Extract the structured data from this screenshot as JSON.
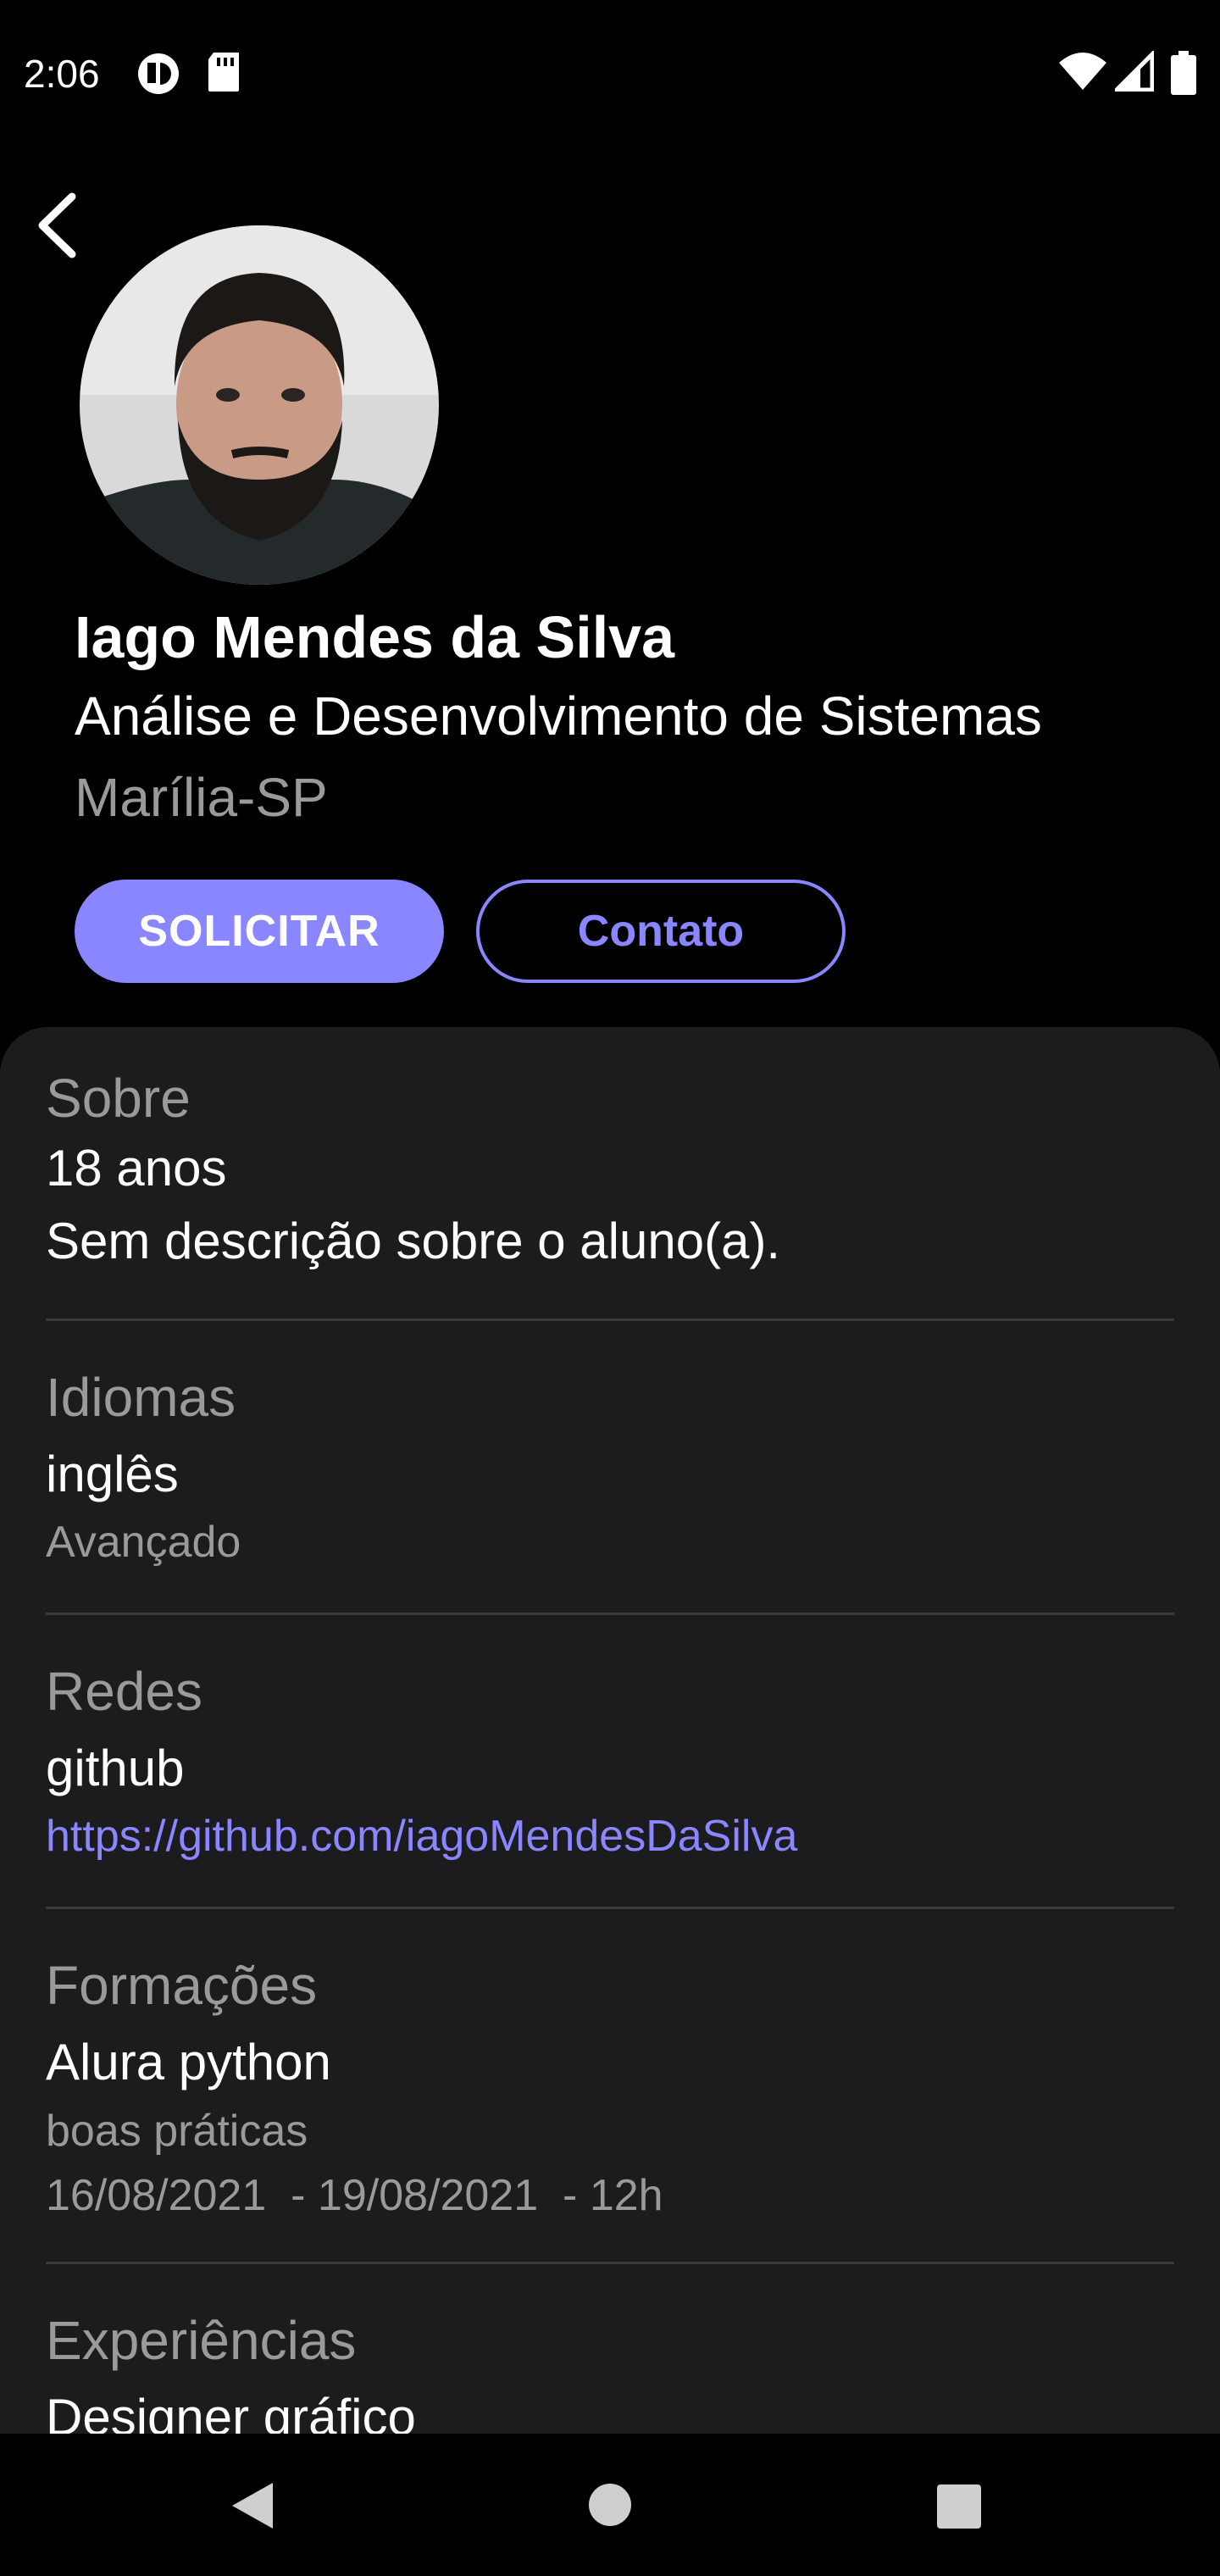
{
  "status_bar": {
    "time": "2:06",
    "icons": [
      "notification-app-icon",
      "sd-card-icon",
      "wifi-icon",
      "signal-icon",
      "battery-icon"
    ]
  },
  "profile": {
    "name": "Iago Mendes da Silva",
    "course": "Análise e Desenvolvimento de Sistemas",
    "city": "Marília-SP",
    "avatar_alt": "profile photo"
  },
  "actions": {
    "solicitar_label": "SOLICITAR",
    "contato_label": "Contato"
  },
  "sections": {
    "sobre": {
      "title": "Sobre",
      "age": "18 anos",
      "description": "Sem descrição sobre o aluno(a)."
    },
    "idiomas": {
      "title": "Idiomas",
      "language": "inglês",
      "level": "Avançado"
    },
    "redes": {
      "title": "Redes",
      "network": "github",
      "url": "https://github.com/iagoMendesDaSilva"
    },
    "formacoes": {
      "title": "Formações",
      "course_name": "Alura python",
      "course_desc": "boas práticas",
      "period": "16/08/2021  - 19/08/2021  - 12h"
    },
    "experiencias": {
      "title": "Experiências",
      "role": "Designer gráfico"
    }
  },
  "colors": {
    "accent": "#8a86ff",
    "background": "#000000",
    "sheet": "#1c1c1e",
    "muted_text": "#9a9a9a",
    "divider": "#3a3a3c"
  },
  "navigation": {
    "icons": [
      "back-triangle-icon",
      "home-circle-icon",
      "recents-square-icon"
    ]
  }
}
